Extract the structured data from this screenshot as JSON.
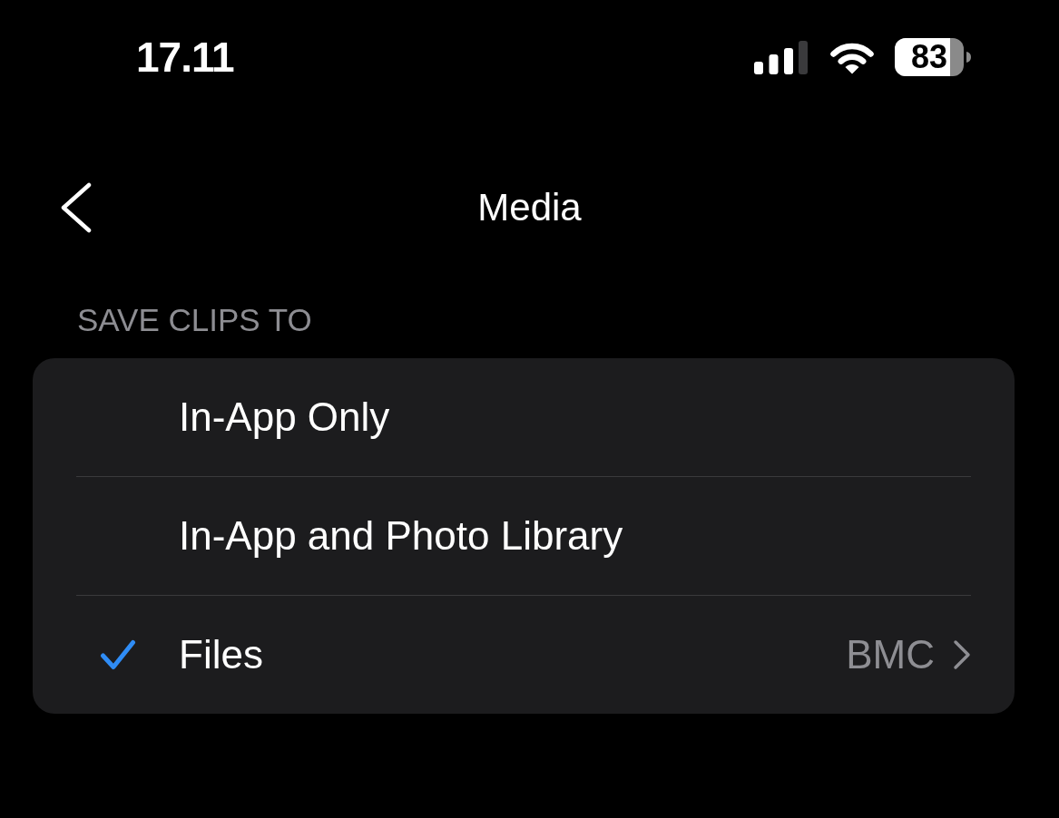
{
  "status_bar": {
    "time": "17.11",
    "battery": "83"
  },
  "nav": {
    "title": "Media"
  },
  "section": {
    "header": "SAVE CLIPS TO",
    "options": [
      {
        "label": "In-App Only",
        "selected": false
      },
      {
        "label": "In-App and Photo Library",
        "selected": false
      },
      {
        "label": "Files",
        "selected": true,
        "value": "BMC"
      }
    ]
  }
}
